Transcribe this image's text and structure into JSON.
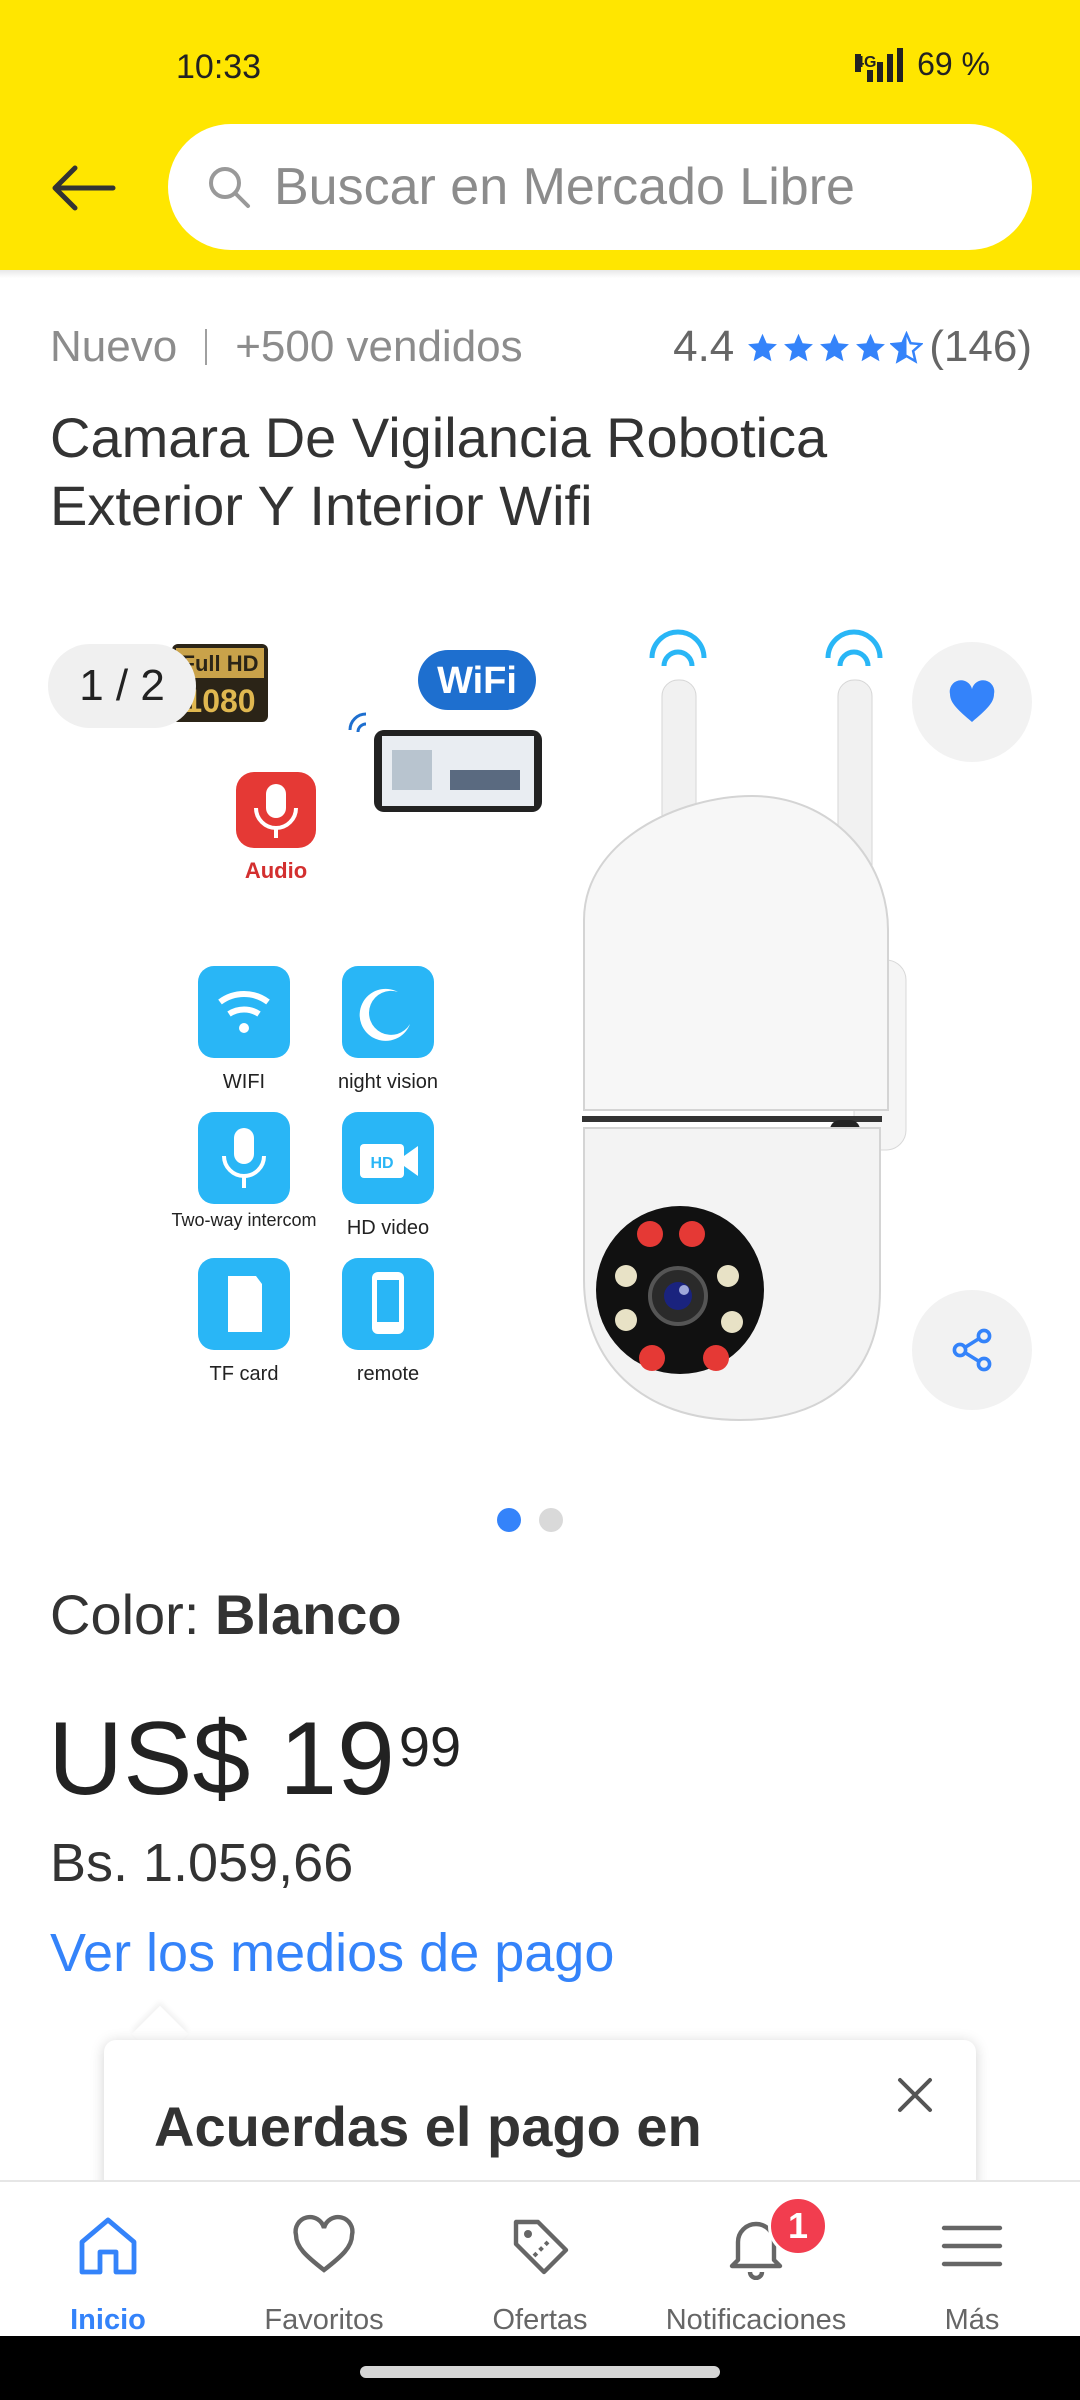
{
  "status": {
    "time": "10:33",
    "network": "4G",
    "battery": "69 %"
  },
  "search": {
    "placeholder": "Buscar en Mercado Libre"
  },
  "product": {
    "condition": "Nuevo",
    "sold": "+500 vendidos",
    "rating": "4.4",
    "rating_stars": 4.5,
    "reviews": "(146)",
    "title": "Camara De Vigilancia Robotica Exterior Y Interior Wifi"
  },
  "gallery": {
    "counter": "1 / 2",
    "dots_total": 2,
    "dot_active": 1,
    "image_labels": {
      "full_hd": "Full HD",
      "res": "1080",
      "wifi_logo": "WiFi",
      "audio": "Audio",
      "features": [
        "WIFI",
        "night vision",
        "Two-way intercom",
        "HD video",
        "TF card",
        "remote"
      ],
      "hd_badge": "HD"
    }
  },
  "color": {
    "label": "Color: ",
    "value": "Blanco"
  },
  "price": {
    "usd_main": "US$ 19",
    "usd_cents": "99",
    "bs": "Bs. 1.059,66",
    "payment_link": "Ver los medios de pago"
  },
  "tooltip": {
    "text": "Acuerdas el pago en"
  },
  "nav": [
    {
      "label": "Inicio",
      "icon": "home-icon"
    },
    {
      "label": "Favoritos",
      "icon": "heart-icon"
    },
    {
      "label": "Ofertas",
      "icon": "tag-icon"
    },
    {
      "label": "Notificaciones",
      "icon": "bell-icon",
      "badge": "1"
    },
    {
      "label": "Más",
      "icon": "menu-icon"
    }
  ],
  "colors": {
    "header": "#FFE600",
    "accent": "#3483FA",
    "badge": "#F23D4F"
  }
}
